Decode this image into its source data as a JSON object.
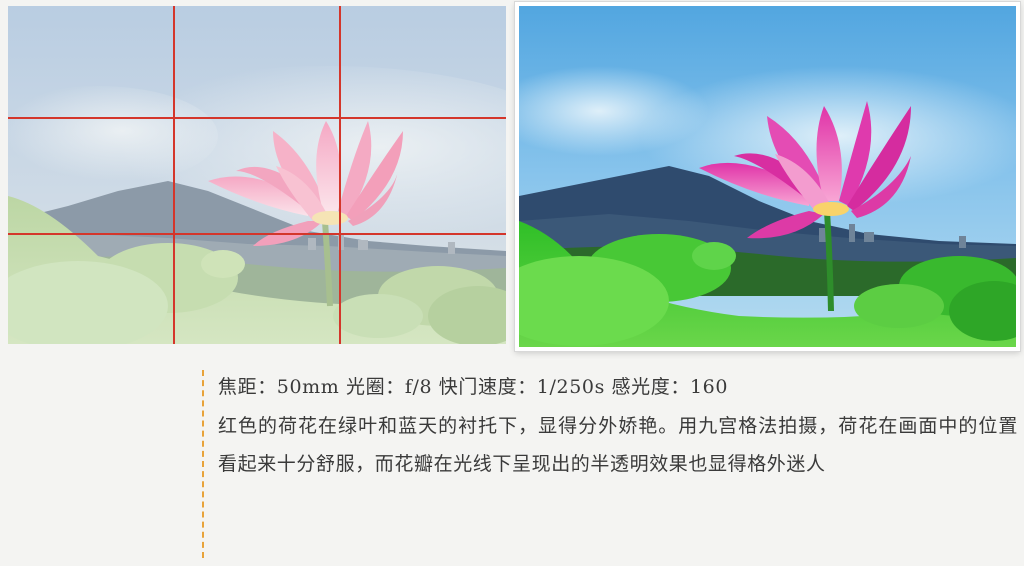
{
  "photos": {
    "left": {
      "name": "photo-with-grid",
      "grid": {
        "show": true,
        "color": "#d4362b",
        "rows": 3,
        "cols": 3
      }
    },
    "right": {
      "name": "photo-vivid"
    }
  },
  "caption": {
    "specs": "焦距：50mm 光圈：f/8 快门速度：1/250s 感光度：160",
    "description": "红色的荷花在绿叶和蓝天的衬托下，显得分外娇艳。用九宫格法拍摄，荷花在画面中的位置看起来十分舒服，而花瓣在光线下呈现出的半透明效果也显得格外迷人",
    "accent_color": "#e8a33a"
  }
}
